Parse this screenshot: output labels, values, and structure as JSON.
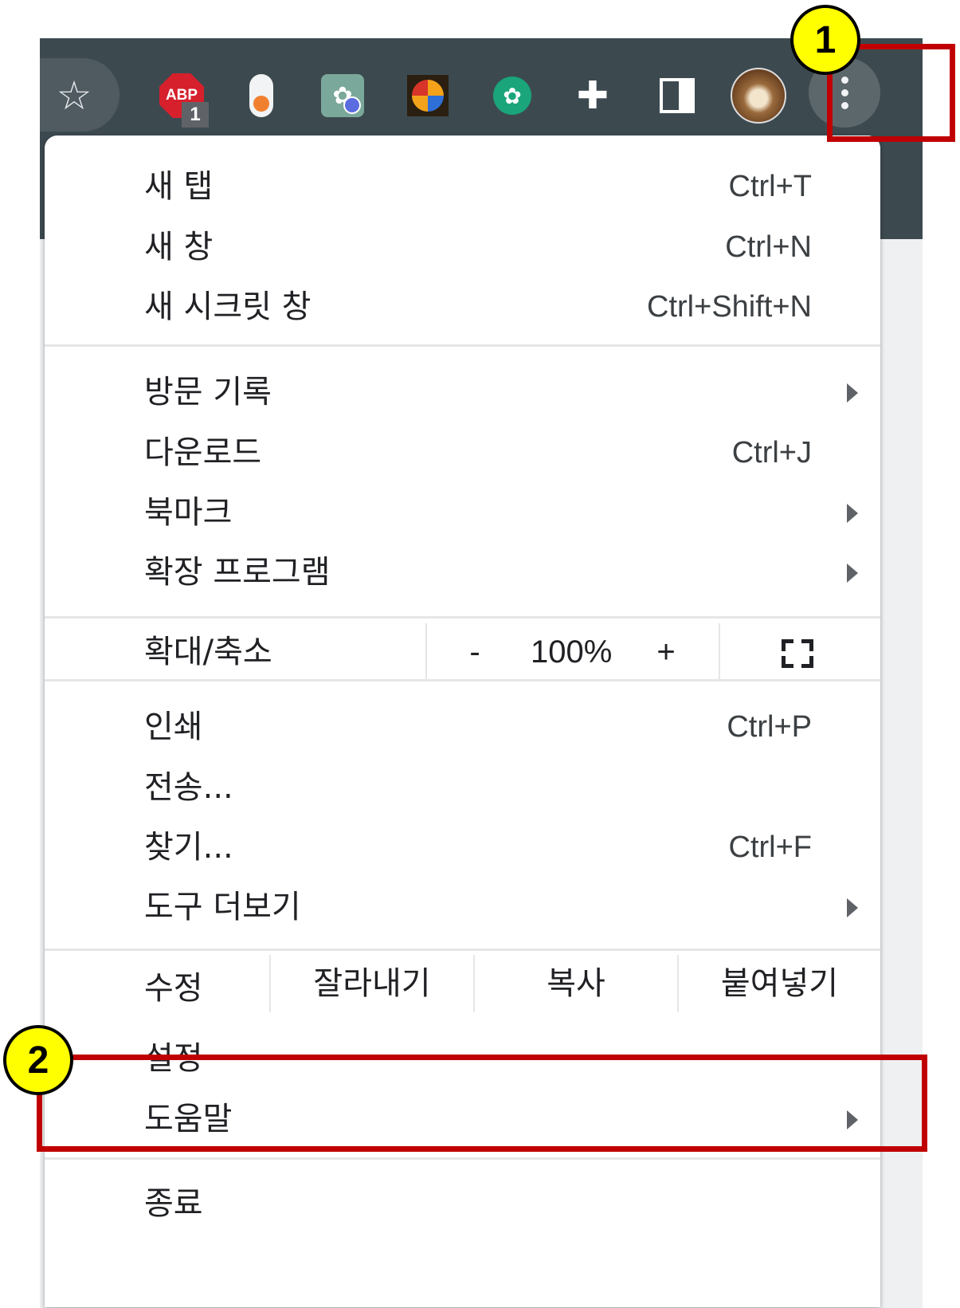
{
  "toolbar": {
    "extensions": {
      "abp_label": "ABP",
      "abp_count": "1"
    }
  },
  "menu": {
    "section1": [
      {
        "label": "새 탭",
        "shortcut": "Ctrl+T"
      },
      {
        "label": "새 창",
        "shortcut": "Ctrl+N"
      },
      {
        "label": "새 시크릿 창",
        "shortcut": "Ctrl+Shift+N"
      }
    ],
    "section2": [
      {
        "label": "방문 기록",
        "shortcut": ""
      },
      {
        "label": "다운로드",
        "shortcut": "Ctrl+J"
      },
      {
        "label": "북마크",
        "shortcut": ""
      },
      {
        "label": "확장 프로그램",
        "shortcut": ""
      }
    ],
    "zoom": {
      "label": "확대/축소",
      "minus": "-",
      "value": "100%",
      "plus": "+"
    },
    "section3": [
      {
        "label": "인쇄",
        "shortcut": "Ctrl+P"
      },
      {
        "label": "전송...",
        "shortcut": ""
      },
      {
        "label": "찾기...",
        "shortcut": "Ctrl+F"
      },
      {
        "label": "도구 더보기",
        "shortcut": ""
      }
    ],
    "edit": {
      "label": "수정",
      "cut": "잘라내기",
      "copy": "복사",
      "paste": "붙여넣기"
    },
    "settings": "설정",
    "help": "도움말",
    "exit": "종료"
  },
  "annotations": {
    "step1": "1",
    "step2": "2",
    "highlight_color": "#c00000",
    "badge_color": "#ffff00"
  }
}
